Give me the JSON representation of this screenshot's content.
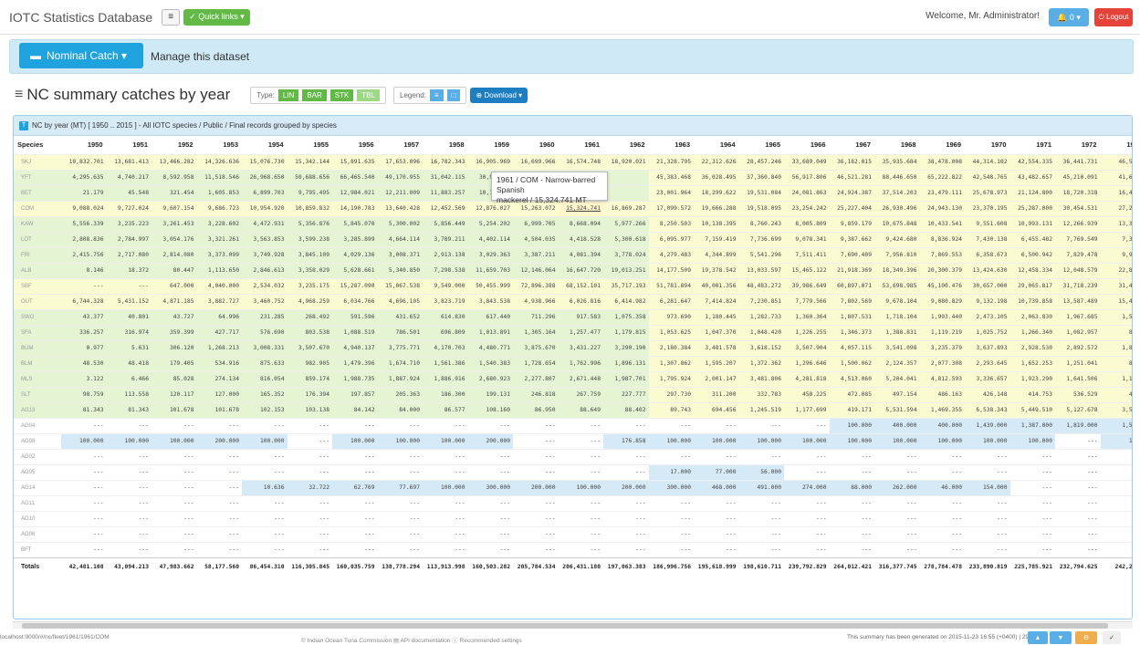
{
  "navbar": {
    "brand": "IOTC Statistics Database",
    "menu_icon": "≡",
    "quick_links": "✓ Quick links ▾",
    "welcome": "Welcome, Mr. Administrator!",
    "bell": "🔔 0 ▾",
    "logout": "⏻ Logout"
  },
  "band": {
    "dataset_button": "Nominal Catch ▾",
    "manage": "Manage this dataset"
  },
  "page": {
    "icon": "≡",
    "title": "NC summary catches by year",
    "type_label": "Type:",
    "types": [
      "LIN",
      "BAR",
      "STK",
      "TBL"
    ],
    "legend_label": "Legend:",
    "legend_btns": [
      "≡",
      "□"
    ],
    "download": "⊕ Download ▾"
  },
  "panel": {
    "icon": "T",
    "title": "NC by year (MT) [ 1950 .. 2015 ] - All IOTC species / Public / Final records grouped by species"
  },
  "table": {
    "header_first": "Species",
    "years": [
      "1950",
      "1951",
      "1952",
      "1953",
      "1954",
      "1955",
      "1956",
      "1957",
      "1958",
      "1959",
      "1960",
      "1961",
      "1962",
      "1963",
      "1964",
      "1965",
      "1966",
      "1967",
      "1968",
      "1969",
      "1970",
      "1971",
      "1972",
      "1973"
    ],
    "rows": [
      {
        "species": "SKJ",
        "values": [
          "10,832.701",
          "13,681.413",
          "13,466.282",
          "14,326.636",
          "15,076.730",
          "15,342.144",
          "15,891.635",
          "17,653.096",
          "16,782.343",
          "16,905.969",
          "16,699.966",
          "16,574.748",
          "18,920.021",
          "21,328.795",
          "22,312.626",
          "28,457.246",
          "33,689.049",
          "36,182.015",
          "35,935.684",
          "38,478.008",
          "44,314.102",
          "42,554.335",
          "36,441.731",
          "46,537."
        ]
      },
      {
        "species": "YFT",
        "values": [
          "4,295.635",
          "4,740.217",
          "8,592.958",
          "11,518.546",
          "26,968.650",
          "50,688.656",
          "66,465.540",
          "49,170.955",
          "31,042.115",
          "30,941.35",
          "",
          "",
          "",
          "45,383.468",
          "36,028.495",
          "37,360.840",
          "56,917.806",
          "46,521.281",
          "88,446.650",
          "65,222.822",
          "42,548.765",
          "43,482.657",
          "45,210.091",
          "41,623."
        ]
      },
      {
        "species": "BET",
        "values": [
          "21.179",
          "45.548",
          "321.454",
          "1,605.853",
          "6,899.703",
          "9,795.495",
          "12,984.021",
          "12,211.009",
          "11,883.257",
          "10,103.30",
          "",
          "",
          "",
          "23,001.964",
          "18,299.622",
          "19,531.084",
          "24,081.863",
          "24,924.387",
          "37,514.203",
          "23,479.111",
          "25,678.973",
          "21,124.800",
          "18,720.318",
          "16,450."
        ]
      },
      {
        "species": "COM",
        "values": [
          "9,088.024",
          "9,727.024",
          "9,607.154",
          "9,686.723",
          "10,954.920",
          "10,859.832",
          "14,190.783",
          "13,640.428",
          "12,452.569",
          "12,876.027",
          "15,263.072",
          "15,324.741",
          "16,869.287",
          "17,099.572",
          "19,666.288",
          "19,518.095",
          "23,254.242",
          "25,227.404",
          "26,930.496",
          "24,943.130",
          "23,370.195",
          "25,287.000",
          "30,454.531",
          "27,269."
        ]
      },
      {
        "species": "KAW",
        "values": [
          "5,556.339",
          "3,235.223",
          "3,261.453",
          "3,228.602",
          "4,472.931",
          "5,356.876",
          "5,845.070",
          "5,300.002",
          "5,856.449",
          "5,254.202",
          "6,999.705",
          "8,668.094",
          "5,977.266",
          "8,250.503",
          "10,138.395",
          "8,760.243",
          "8,005.809",
          "9,859.179",
          "10,675.848",
          "10,433.541",
          "9,551.608",
          "10,993.131",
          "12,266.939",
          "13,306."
        ]
      },
      {
        "species": "LOT",
        "values": [
          "2,808.836",
          "2,784.997",
          "3,054.176",
          "3,321.261",
          "3,563.853",
          "3,599.238",
          "3,285.899",
          "4,664.114",
          "3,789.211",
          "4,402.114",
          "4,504.035",
          "4,418.528",
          "5,300.618",
          "6,095.977",
          "7,159.419",
          "7,736.699",
          "9,078.341",
          "9,387.662",
          "9,424.680",
          "8,836.924",
          "7,430.138",
          "6,455.482",
          "7,769.549",
          "7,326."
        ]
      },
      {
        "species": "FRI",
        "values": [
          "2,415.756",
          "2,717.080",
          "2,814.080",
          "3,373.099",
          "3,749.928",
          "3,845.109",
          "4,029.136",
          "3,008.371",
          "2,913.138",
          "3,029.363",
          "3,387.211",
          "4,081.394",
          "3,778.024",
          "4,279.483",
          "4,344.899",
          "5,541.296",
          "7,511.411",
          "7,690.409",
          "7,956.810",
          "7,869.553",
          "6,358.673",
          "6,500.942",
          "7,829.478",
          "9,906."
        ]
      },
      {
        "species": "ALB",
        "values": [
          "8.146",
          "18.372",
          "80.447",
          "1,113.650",
          "2,846.613",
          "3,358.029",
          "5,628.661",
          "5,340.850",
          "7,298.538",
          "11,659.703",
          "12,146.064",
          "16,647.720",
          "19,013.251",
          "14,177.509",
          "19,378.542",
          "13,033.597",
          "15,465.122",
          "21,918.369",
          "18,349.396",
          "20,300.379",
          "13,424.630",
          "12,458.334",
          "12,048.579",
          "22,809."
        ]
      },
      {
        "species": "SBF",
        "values": [
          "---",
          "---",
          "647.000",
          "4,040.000",
          "2,534.032",
          "3,235.175",
          "15,287.090",
          "15,067.538",
          "9,549.000",
          "50,455.999",
          "72,896.388",
          "68,152.101",
          "35,717.193",
          "51,781.894",
          "40,001.356",
          "48,483.272",
          "39,986.649",
          "60,897.071",
          "53,698.985",
          "45,100.476",
          "30,657.000",
          "29,065.817",
          "31,718.239",
          "31,462."
        ]
      },
      {
        "species": "OUT",
        "values": [
          "6,744.328",
          "5,431.152",
          "4,871.185",
          "3,882.727",
          "3,460.752",
          "4,968.259",
          "6,034.766",
          "4,696.105",
          "3,823.719",
          "3,843.538",
          "4,938.966",
          "6,026.816",
          "6,414.982",
          "6,281.647",
          "7,414.824",
          "7,230.851",
          "7,779.566",
          "7,802.569",
          "9,678.104",
          "9,080.829",
          "9,132.198",
          "10,739.858",
          "13,587.489",
          "15,484."
        ]
      },
      {
        "species": "SWO",
        "values": [
          "43.377",
          "40.801",
          "43.727",
          "64.996",
          "231.285",
          "268.492",
          "591.596",
          "431.652",
          "614.830",
          "617.440",
          "711.296",
          "917.583",
          "1,075.358",
          "973.690",
          "1,180.445",
          "1,282.733",
          "1,360.364",
          "1,807.531",
          "1,718.104",
          "1,993.440",
          "2,473.105",
          "2,063.830",
          "1,967.685",
          "1,595."
        ]
      },
      {
        "species": "SFA",
        "values": [
          "336.257",
          "316.974",
          "359.399",
          "427.717",
          "576.690",
          "803.538",
          "1,088.519",
          "786.501",
          "696.809",
          "1,013.891",
          "1,305.164",
          "1,257.477",
          "1,179.815",
          "1,053.625",
          "1,047.370",
          "1,048.420",
          "1,226.255",
          "1,346.373",
          "1,388.831",
          "1,119.219",
          "1,025.752",
          "1,266.340",
          "1,082.957",
          "860."
        ]
      },
      {
        "species": "BUM",
        "values": [
          "0.977",
          "5.631",
          "306.120",
          "1,268.213",
          "3,008.331",
          "3,507.670",
          "4,940.137",
          "3,775.771",
          "4,170.703",
          "4,480.771",
          "3,875.670",
          "3,431.227",
          "3,290.190",
          "2,180.384",
          "3,481.578",
          "3,618.152",
          "3,507.904",
          "4,057.115",
          "3,541.098",
          "3,235.379",
          "3,637.893",
          "2,928.530",
          "2,892.572",
          "1,872."
        ]
      },
      {
        "species": "BLM",
        "values": [
          "48.530",
          "48.418",
          "179.405",
          "534.916",
          "875.633",
          "982.905",
          "1,479.396",
          "1,674.710",
          "1,561.386",
          "1,540.383",
          "1,728.654",
          "1,762.996",
          "1,896.131",
          "1,307.862",
          "1,595.207",
          "1,372.362",
          "1,296.646",
          "1,500.062",
          "2,124.357",
          "2,077.308",
          "2,293.645",
          "1,652.253",
          "1,251.041",
          "888."
        ]
      },
      {
        "species": "MLS",
        "values": [
          "3.122",
          "6.466",
          "85.028",
          "274.134",
          "816.054",
          "859.174",
          "1,988.735",
          "1,887.924",
          "1,886.916",
          "2,680.923",
          "2,277.807",
          "2,671.448",
          "1,987.701",
          "1,795.924",
          "2,001.147",
          "3,481.806",
          "4,281.818",
          "4,513.060",
          "5,204.041",
          "4,812.593",
          "3,336.657",
          "1,923.290",
          "1,641.506",
          "1,184."
        ]
      },
      {
        "species": "SLT",
        "values": [
          "98.759",
          "113.558",
          "120.117",
          "127.000",
          "165.352",
          "176.394",
          "197.857",
          "205.363",
          "186.300",
          "199.131",
          "246.818",
          "267.759",
          "227.777",
          "297.730",
          "311.200",
          "332.783",
          "458.225",
          "472.085",
          "497.154",
          "486.163",
          "426.148",
          "414.753",
          "536.529",
          "489."
        ]
      },
      {
        "species": "AG13",
        "values": [
          "81.343",
          "81.343",
          "101.678",
          "101.678",
          "102.153",
          "103.138",
          "84.142",
          "84.000",
          "86.577",
          "108.160",
          "86.950",
          "88.649",
          "88.402",
          "89.743",
          "694.456",
          "1,245.519",
          "1,177.699",
          "419.171",
          "5,531.594",
          "1,469.355",
          "6,538.343",
          "5,449.510",
          "5,127.678",
          "3,575."
        ]
      },
      {
        "species": "AG04",
        "values": [
          "---",
          "---",
          "---",
          "---",
          "---",
          "---",
          "---",
          "---",
          "---",
          "---",
          "---",
          "---",
          "---",
          "---",
          "---",
          "---",
          "---",
          "100.000",
          "400.000",
          "400.000",
          "1,439.000",
          "1,387.000",
          "1,819.000",
          "1,585."
        ]
      },
      {
        "species": "AG08",
        "values": [
          "100.000",
          "100.000",
          "100.000",
          "200.000",
          "100.000",
          "---",
          "100.000",
          "100.000",
          "100.000",
          "200.000",
          "---",
          "---",
          "176.858",
          "100.000",
          "100.000",
          "100.000",
          "100.000",
          "100.000",
          "100.000",
          "100.000",
          "100.000",
          "100.000",
          "---",
          "100."
        ]
      },
      {
        "species": "AG02",
        "values": [
          "---",
          "---",
          "---",
          "---",
          "---",
          "---",
          "---",
          "---",
          "---",
          "---",
          "---",
          "---",
          "---",
          "---",
          "---",
          "---",
          "---",
          "---",
          "---",
          "---",
          "---",
          "---",
          "---",
          "---"
        ]
      },
      {
        "species": "AG05",
        "values": [
          "---",
          "---",
          "---",
          "---",
          "---",
          "---",
          "---",
          "---",
          "---",
          "---",
          "---",
          "---",
          "---",
          "17.000",
          "77.000",
          "56.000",
          "---",
          "---",
          "---",
          "---",
          "---",
          "---",
          "---",
          "---"
        ]
      },
      {
        "species": "AG14",
        "values": [
          "---",
          "---",
          "---",
          "---",
          "10.636",
          "32.722",
          "62.769",
          "77.697",
          "100.000",
          "300.000",
          "200.000",
          "100.000",
          "200.000",
          "300.000",
          "468.000",
          "491.000",
          "274.000",
          "88.000",
          "262.000",
          "46.000",
          "154.000",
          "---",
          "---",
          "---"
        ]
      },
      {
        "species": "AG11",
        "values": [
          "---",
          "---",
          "---",
          "---",
          "---",
          "---",
          "---",
          "---",
          "---",
          "---",
          "---",
          "---",
          "---",
          "---",
          "---",
          "---",
          "---",
          "---",
          "---",
          "---",
          "---",
          "---",
          "---",
          "---"
        ]
      },
      {
        "species": "AG10",
        "values": [
          "---",
          "---",
          "---",
          "---",
          "---",
          "---",
          "---",
          "---",
          "---",
          "---",
          "---",
          "---",
          "---",
          "---",
          "---",
          "---",
          "---",
          "---",
          "---",
          "---",
          "---",
          "---",
          "---",
          "---"
        ]
      },
      {
        "species": "AG06",
        "values": [
          "---",
          "---",
          "---",
          "---",
          "---",
          "---",
          "---",
          "---",
          "---",
          "---",
          "---",
          "---",
          "---",
          "---",
          "---",
          "---",
          "---",
          "---",
          "---",
          "---",
          "---",
          "---",
          "---",
          "---"
        ]
      },
      {
        "species": "BFT",
        "values": [
          "---",
          "---",
          "---",
          "---",
          "---",
          "---",
          "---",
          "---",
          "---",
          "---",
          "---",
          "---",
          "---",
          "---",
          "---",
          "---",
          "---",
          "---",
          "---",
          "---",
          "---",
          "---",
          "---",
          "---"
        ]
      }
    ],
    "totals": {
      "species": "Totals",
      "values": [
        "42,481.108",
        "43,094.213",
        "47,983.662",
        "58,177.560",
        "86,454.310",
        "116,305.845",
        "160,035.759",
        "138,778.294",
        "113,913.998",
        "160,503.282",
        "205,784.534",
        "206,431.180",
        "197,063.383",
        "186,996.756",
        "195,618.999",
        "198,610.711",
        "239,792.829",
        "264,012.421",
        "316,377.745",
        "278,784.478",
        "233,890.819",
        "225,785.921",
        "232,794.625",
        "242,260."
      ]
    }
  },
  "tooltip": {
    "line1": "1961 / COM - Narrow-barred Spanish",
    "line2": "mackerel / 15,324.741 MT"
  },
  "footer": {
    "status_url": "localhost:9000/#/nc/fleet/1961/1961/COM",
    "left": "© Indian Ocean Tuna Commission  ▤ API documentation  ⓘ Recommended settings",
    "right": "This summary has been generated on 2015-11-23 16:55 (+0400) | 296 | 545"
  },
  "colors": {
    "accent": "#1fa3df",
    "green": "#62b946",
    "header_band": "#cfe9f6",
    "logout": "#e5423a",
    "row_yellow": "#fbfbd2",
    "row_green": "#e5f5d3",
    "row_blue": "#d5e9f7"
  }
}
